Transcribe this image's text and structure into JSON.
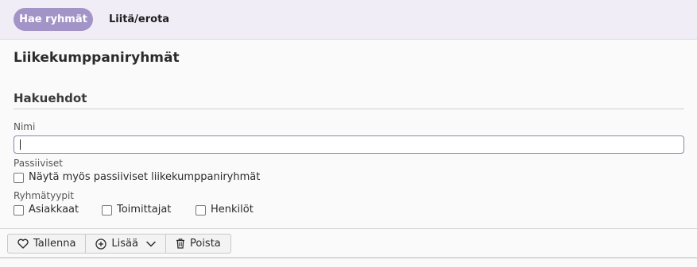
{
  "topbar": {
    "active_tab": "Hae ryhmät",
    "second_tab": "Liitä/erota"
  },
  "page": {
    "title": "Liikekumppaniryhmät"
  },
  "search": {
    "section_title": "Hakuehdot",
    "name_label": "Nimi",
    "name_value": "",
    "passive_label": "Passiiviset",
    "passive_checkbox_label": "Näytä myös passiiviset liikekumppaniryhmät",
    "group_types_label": "Ryhmätyypit",
    "group_types": [
      {
        "label": "Asiakkaat",
        "checked": false
      },
      {
        "label": "Toimittajat",
        "checked": false
      },
      {
        "label": "Henkilöt",
        "checked": false
      }
    ]
  },
  "toolbar": {
    "save_label": "Tallenna",
    "save_icon": "heart-icon",
    "add_label": "Lisää",
    "add_icon": "plus-circle-icon",
    "add_dropdown_icon": "chevron-down-icon",
    "delete_label": "Poista",
    "delete_icon": "trash-icon"
  },
  "colors": {
    "accent": "#a394c7",
    "topbar_bg": "#f1edf7",
    "input_border": "#8c87a6"
  }
}
